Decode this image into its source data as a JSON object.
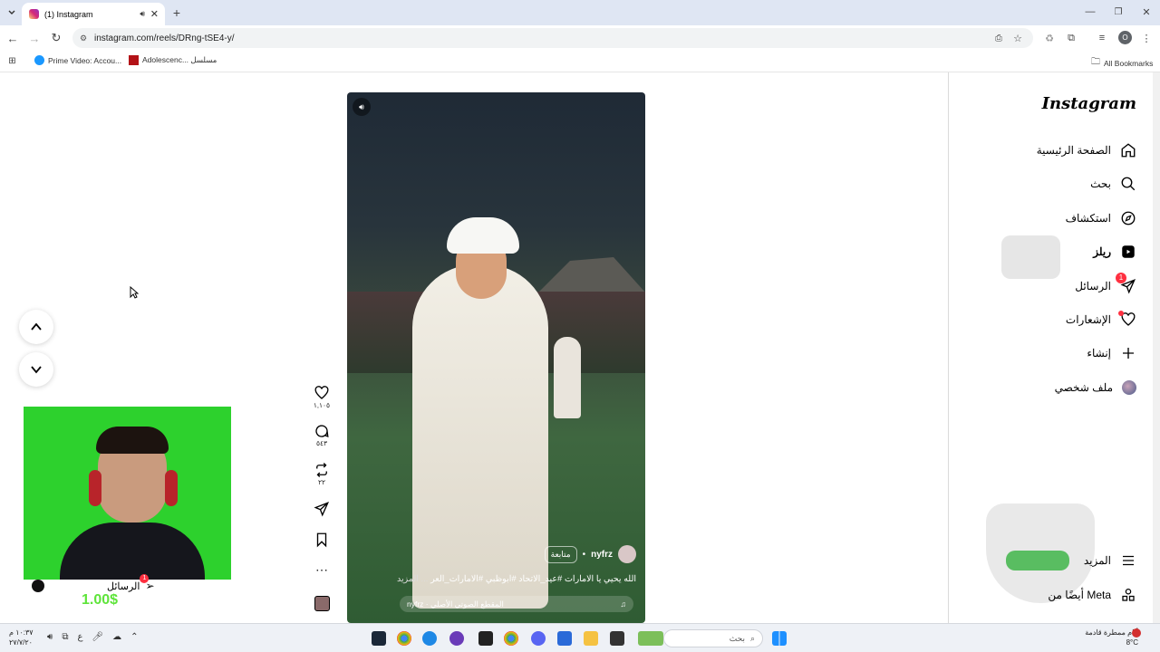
{
  "browser": {
    "tab_title": "(1) Instagram",
    "url": "instagram.com/reels/DRng-tSE4-y/",
    "bookmarks": [
      "Prime Video: Accou...",
      "Adolescenc... مسلسل"
    ],
    "all_bookmarks": "All Bookmarks",
    "profile_initial": "O"
  },
  "sidebar": {
    "logo": "Instagram",
    "items": [
      {
        "label": "الصفحة الرئيسية",
        "icon": "home-icon"
      },
      {
        "label": "بحث",
        "icon": "search-icon"
      },
      {
        "label": "استكشاف",
        "icon": "compass-icon"
      },
      {
        "label": "ريلز",
        "icon": "reels-icon"
      },
      {
        "label": "الرسائل",
        "icon": "messages-icon",
        "badge": "1"
      },
      {
        "label": "الإشعارات",
        "icon": "heart-icon"
      },
      {
        "label": "إنشاء",
        "icon": "plus-icon"
      },
      {
        "label": "ملف شخصي",
        "icon": "avatar-icon"
      }
    ],
    "more": "المزيد",
    "also_from_meta": "أيضًا من Meta"
  },
  "reel": {
    "username": "nyfrz",
    "follow": "متابعة",
    "caption": "الله يحيي يا الامارات #عيد_الاتحاد #ابوظبي #الامارات_العر",
    "more": "... المزيد",
    "audio": "nyfrz · المقطع الصوتي الأصلي"
  },
  "actions": {
    "likes": "١,١٠٥",
    "comments": "٥٤٣",
    "reposts": "٢٢"
  },
  "overlay": {
    "messages_label": "الرسائل",
    "messages_badge": "1",
    "amount": "1.00$"
  },
  "taskbar": {
    "search_placeholder": "بحث",
    "weather_text": "أيام ممطرة قادمة",
    "temperature": "8°C",
    "time": "١٠:٣٧ م",
    "date": "٢٧/٧/٢٠",
    "lang": "ع"
  },
  "colors": {
    "accent_badge": "#ff3040",
    "tab_bar": "#dfe6f3",
    "green_screen": "#2dd12d"
  }
}
